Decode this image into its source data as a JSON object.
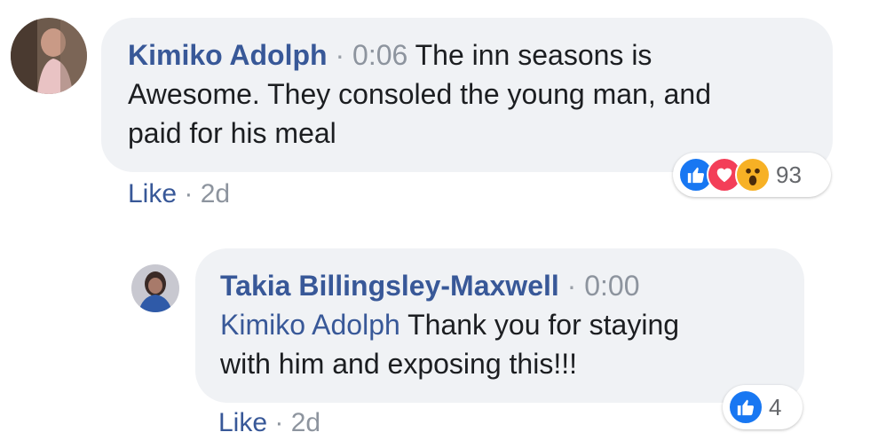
{
  "comments": [
    {
      "author": "Kimiko Adolph",
      "separator": "·",
      "timestamp": "0:06",
      "text_line1": "The inn seasons is",
      "text_line2": "Awesome. They consoled the young man, and",
      "text_line3": "paid for his meal",
      "like_label": "Like",
      "age": "2d",
      "reactions": [
        "like",
        "love",
        "wow"
      ],
      "reaction_count": "93"
    },
    {
      "author": "Takia Billingsley-Maxwell",
      "separator": "·",
      "timestamp": "0:00",
      "mention": "Kimiko Adolph",
      "text_line1": "Thank you for staying",
      "text_line2": "with him and exposing this!!!",
      "like_label": "Like",
      "age": "2d",
      "reactions": [
        "like"
      ],
      "reaction_count": "4"
    }
  ],
  "colors": {
    "bubble": "#f0f2f5",
    "link": "#385898",
    "meta": "#8d949e",
    "like_blue": "#1877f2",
    "love_red": "#f33e58",
    "wow_yellow": "#f7b125"
  }
}
